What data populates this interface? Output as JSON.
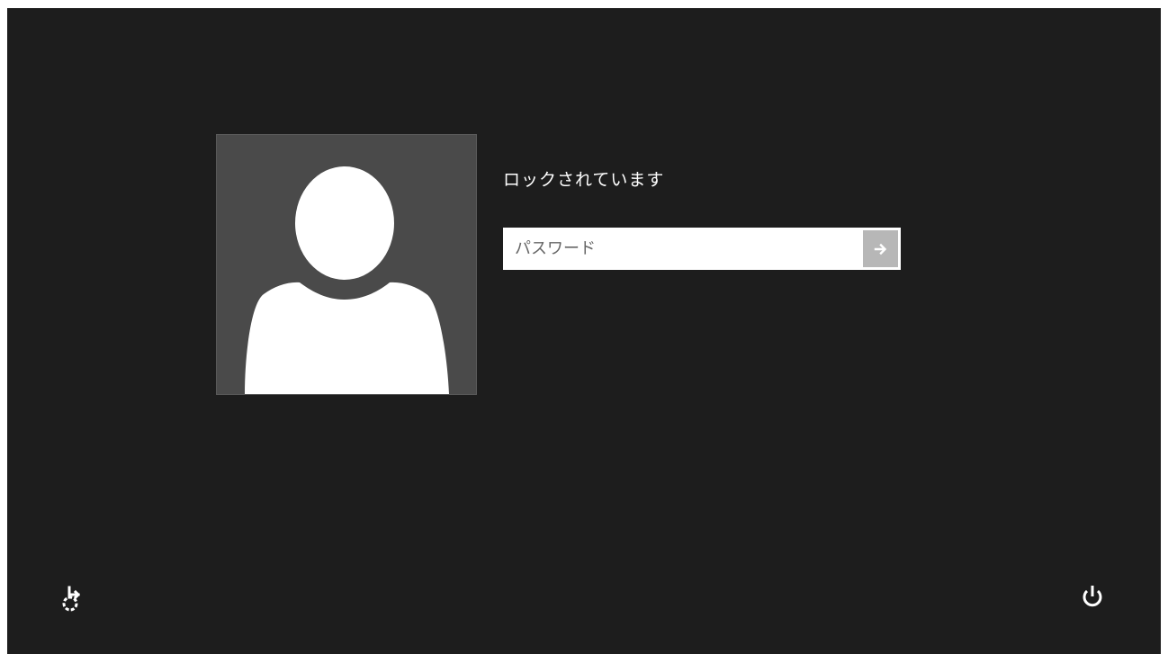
{
  "lock_screen": {
    "status_text": "ロックされています",
    "password": {
      "placeholder": "パスワード",
      "value": ""
    },
    "submit_icon": "arrow-right-icon",
    "bottom_left_icon": "ease-of-access-icon",
    "bottom_right_icon": "power-icon",
    "avatar_icon": "user-silhouette-icon"
  },
  "colors": {
    "background": "#1d1d1d",
    "avatar_tile": "#4a4a4a",
    "submit_button": "#b7b7b7",
    "text": "#ffffff"
  }
}
